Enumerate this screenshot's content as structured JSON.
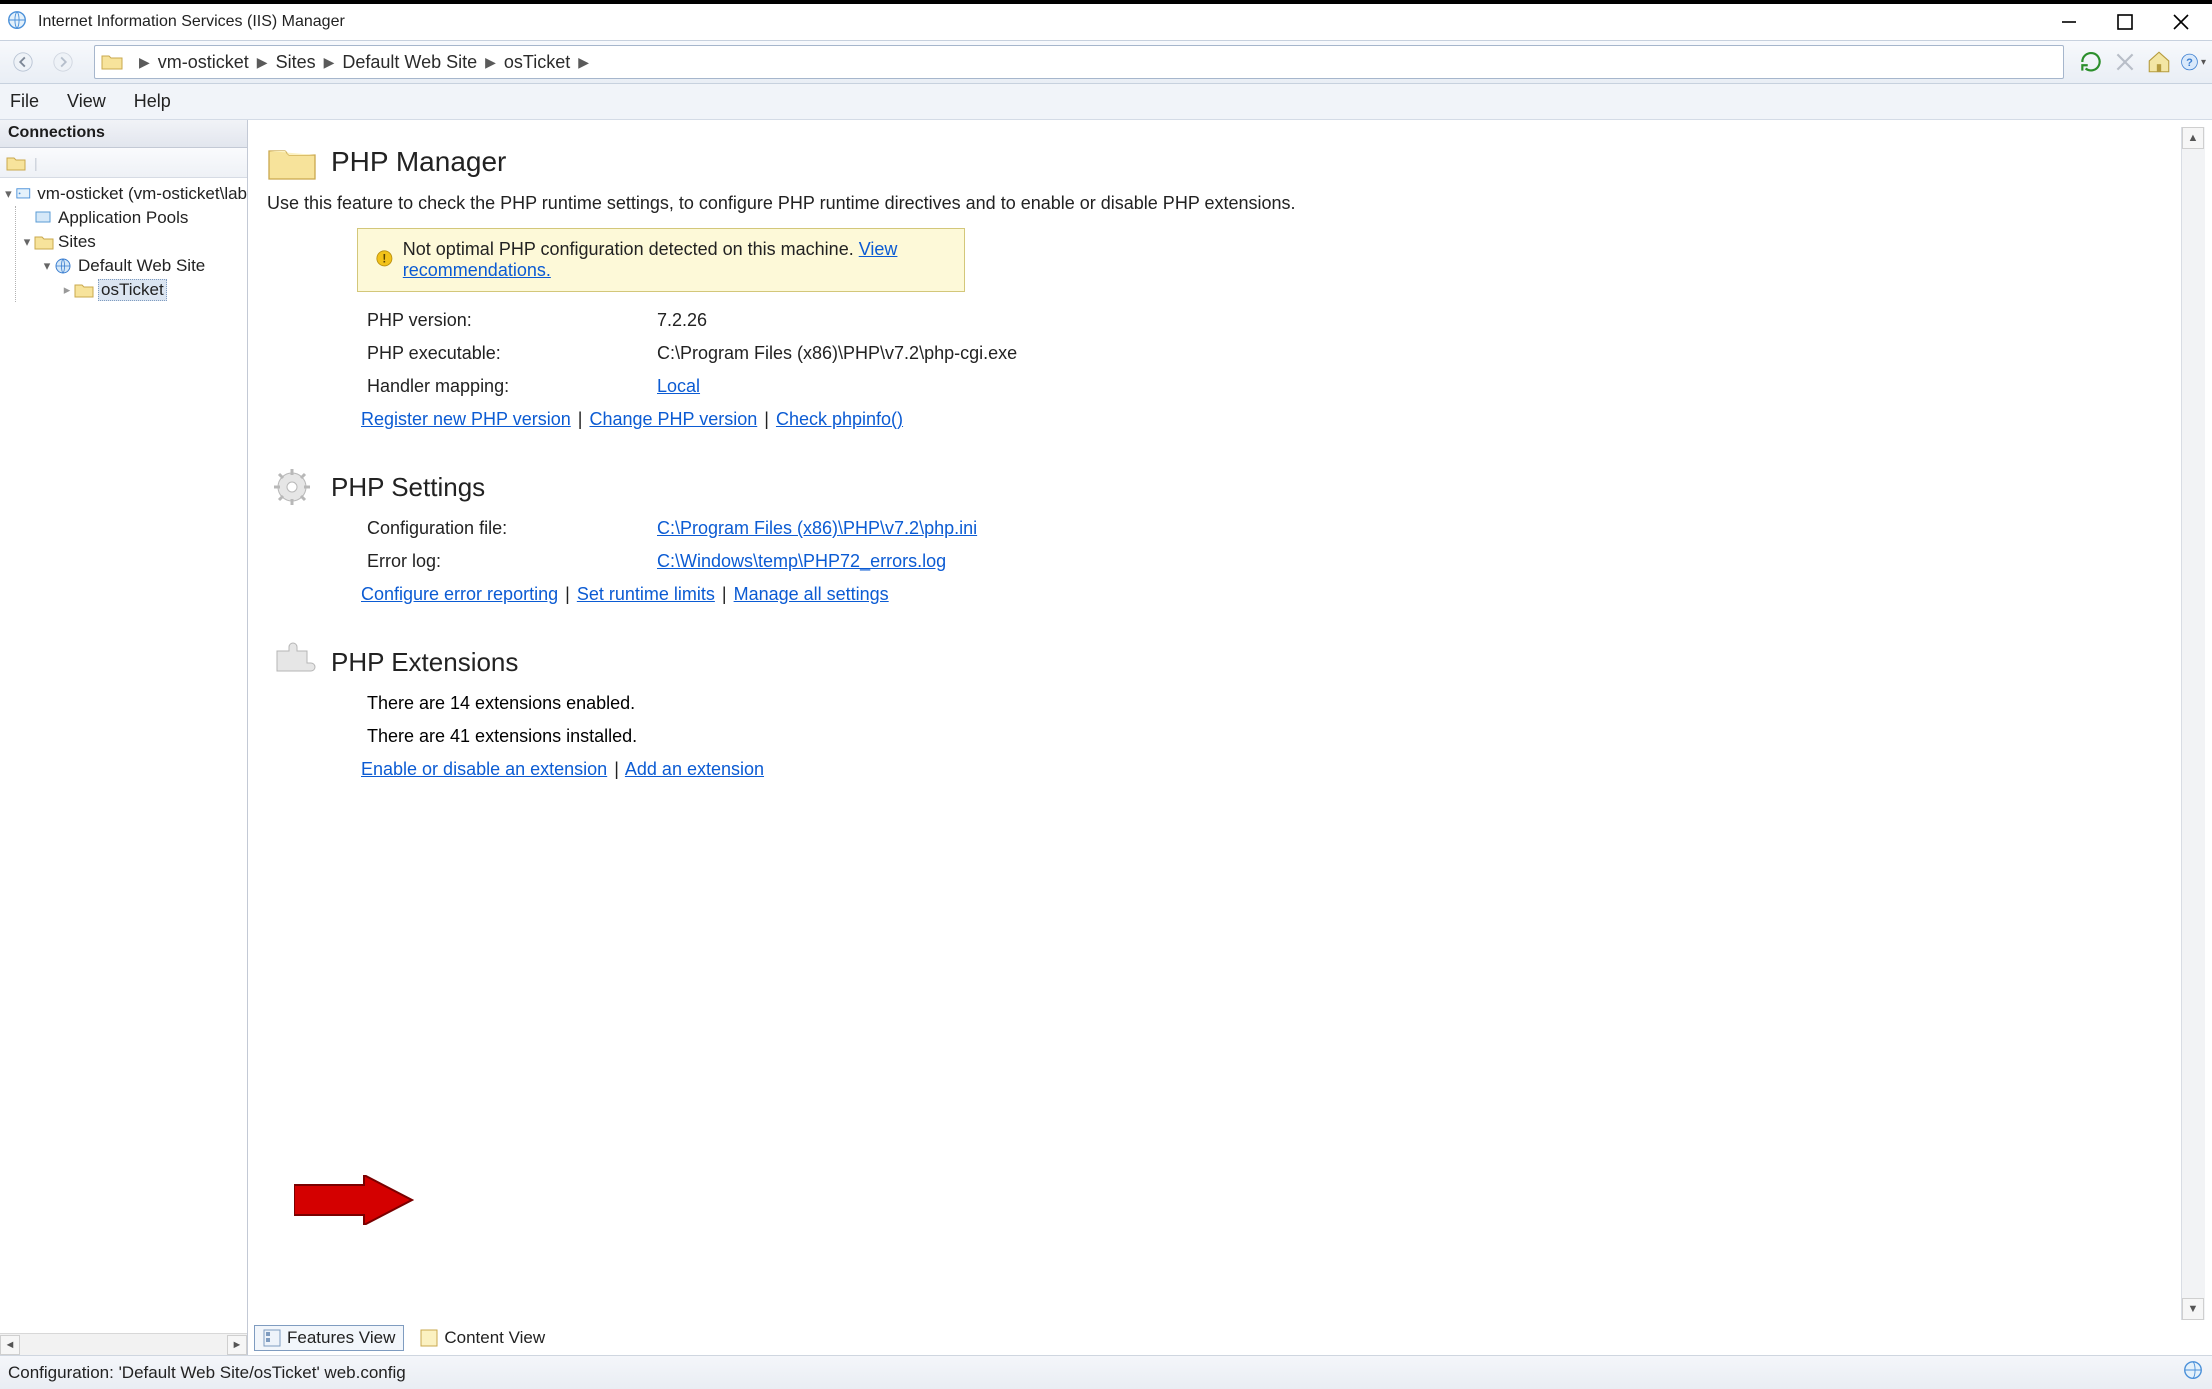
{
  "window": {
    "title": "Internet Information Services (IIS) Manager"
  },
  "breadcrumb": {
    "items": [
      "vm-osticket",
      "Sites",
      "Default Web Site",
      "osTicket"
    ]
  },
  "menu": {
    "file": "File",
    "view": "View",
    "help": "Help"
  },
  "left_panel": {
    "title": "Connections",
    "tree": {
      "root": "vm-osticket (vm-osticket\\lab",
      "app_pools": "Application Pools",
      "sites": "Sites",
      "default_site": "Default Web Site",
      "osticket": "osTicket"
    }
  },
  "php_manager": {
    "title": "PHP Manager",
    "desc": "Use this feature to check the PHP runtime settings, to configure PHP runtime directives and to enable or disable PHP extensions.",
    "warning_text": "Not optimal PHP configuration detected on this machine.",
    "warning_link": "View recommendations.",
    "rows": {
      "version_label": "PHP version:",
      "version_value": "7.2.26",
      "exec_label": "PHP executable:",
      "exec_value": "C:\\Program Files (x86)\\PHP\\v7.2\\php-cgi.exe",
      "handler_label": "Handler mapping:",
      "handler_value": "Local"
    },
    "links": {
      "register": "Register new PHP version",
      "change": "Change PHP version",
      "check": "Check phpinfo()"
    }
  },
  "php_settings": {
    "title": "PHP Settings",
    "rows": {
      "config_label": "Configuration file:",
      "config_value": "C:\\Program Files (x86)\\PHP\\v7.2\\php.ini",
      "errlog_label": "Error log:",
      "errlog_value": "C:\\Windows\\temp\\PHP72_errors.log"
    },
    "links": {
      "configure": "Configure error reporting",
      "limits": "Set runtime limits",
      "manage": "Manage all settings"
    }
  },
  "php_extensions": {
    "title": "PHP Extensions",
    "enabled_text": "There are 14 extensions enabled.",
    "installed_text": "There are 41 extensions installed.",
    "links": {
      "enable": "Enable or disable an extension",
      "add": "Add an extension"
    }
  },
  "bottom_tabs": {
    "features": "Features View",
    "content": "Content View"
  },
  "statusbar": {
    "text": "Configuration: 'Default Web Site/osTicket' web.config"
  }
}
